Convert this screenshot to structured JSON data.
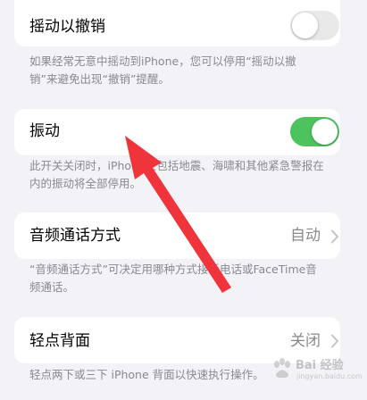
{
  "shake_to_undo": {
    "label": "摇动以撤销",
    "enabled": false,
    "footnote": "如果经常无意中摇动到iPhone，您可以停用“摇动以撤销”来避免出现“撤销”提醒。"
  },
  "vibration": {
    "label": "振动",
    "enabled": true,
    "footnote": "此开关关闭时，iPhone上包括地震、海啸和其他紧急警报在内的振动将全部停用。"
  },
  "call_audio_routing": {
    "label": "音频通话方式",
    "value": "自动",
    "footnote": "“音频通话方式”可决定用哪种方式接听电话或FaceTime音频通话。"
  },
  "back_tap": {
    "label": "轻点背面",
    "value": "关闭",
    "footnote": "轻点两下或三下 iPhone 背面以快速执行操作。"
  },
  "watermark": {
    "text": "Bai 经验",
    "sub": "jingyan.baidu.com"
  },
  "colors": {
    "toggle_on": "#4cc35f",
    "toggle_off": "#e9e9ea",
    "annotation_arrow": "#f0343c"
  },
  "icons": {
    "chevron": "chevron-right-icon",
    "arrow": "red-arrow-annotation-icon",
    "watermark_logo": "baidu-paw-icon"
  }
}
